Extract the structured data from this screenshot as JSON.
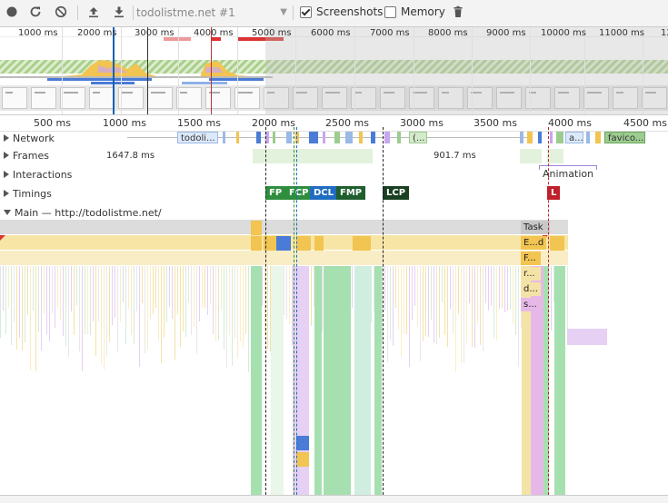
{
  "toolbar": {
    "record_icon": "record-icon",
    "reload_icon": "reload-icon",
    "clear_icon": "clear-icon",
    "upload_icon": "upload-icon",
    "download_icon": "download-icon",
    "recording_select": "todolistme.net #1",
    "screenshots_label": "Screenshots",
    "screenshots_checked": true,
    "memory_label": "Memory",
    "memory_checked": false,
    "gc_icon": "trash-icon"
  },
  "overview": {
    "ticks": [
      "1000 ms",
      "2000 ms",
      "3000 ms",
      "4000 ms",
      "5000 ms",
      "6000 ms",
      "7000 ms",
      "8000 ms",
      "9000 ms",
      "10000 ms",
      "11000 ms",
      "12"
    ]
  },
  "ruler": {
    "ticks": [
      "500 ms",
      "1000 ms",
      "1500 ms",
      "2000 ms",
      "2500 ms",
      "3000 ms",
      "3500 ms",
      "4000 ms",
      "4500 ms"
    ]
  },
  "tracks": {
    "network": "Network",
    "frames": "Frames",
    "interactions": "Interactions",
    "timings": "Timings",
    "main": "Main — http://todolistme.net/"
  },
  "network": {
    "req1": "todoli...",
    "req2": "(...",
    "req3": "a...",
    "req4": "favico..."
  },
  "frames": {
    "t1": "1647.8 ms",
    "t2": "901.7 ms"
  },
  "interactions": {
    "animation": "Animation"
  },
  "timings": {
    "fp": "FP",
    "fcp": "FCP",
    "dcl": "DCL",
    "fmp": "FMP",
    "lcp": "LCP",
    "l": "L"
  },
  "main": {
    "task": "Task",
    "e1": "E...d",
    "e2": "F...",
    "e3": "r...",
    "e4": "d...",
    "e5": "s..."
  },
  "colors": {
    "scripting": "#f2c451",
    "rendering": "#c9a6f0",
    "painting": "#a6e0b0",
    "system": "#cfcfcf",
    "fp": "#2f8e3e",
    "fcp": "#2f8e3e",
    "dcl": "#1f6cc1",
    "fmp": "#1f5f2e",
    "lcp": "#1a3f22",
    "l": "#c0202a"
  }
}
